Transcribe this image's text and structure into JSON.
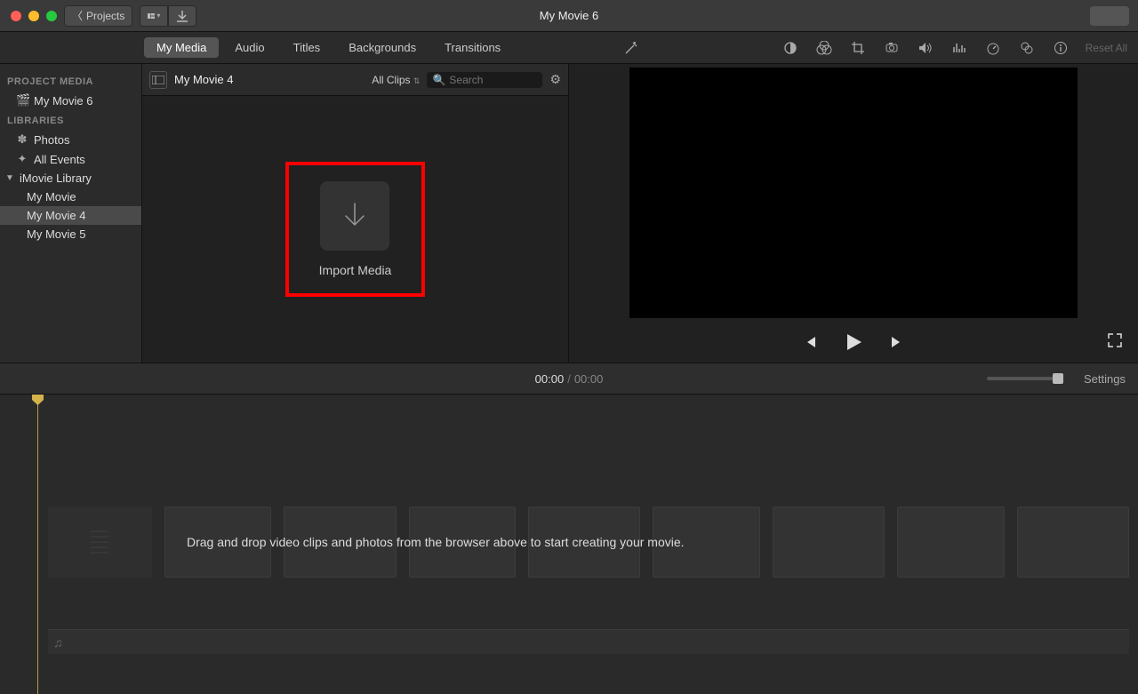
{
  "window": {
    "title": "My Movie 6"
  },
  "toolbar": {
    "back_label": "Projects"
  },
  "tabs": [
    {
      "label": "My Media",
      "active": true
    },
    {
      "label": "Audio"
    },
    {
      "label": "Titles"
    },
    {
      "label": "Backgrounds"
    },
    {
      "label": "Transitions"
    }
  ],
  "adjust_toolbar": {
    "reset_label": "Reset All"
  },
  "sidebar": {
    "sections": [
      {
        "header": "PROJECT MEDIA",
        "items": [
          {
            "label": "My Movie 6",
            "icon": "clapper"
          }
        ]
      },
      {
        "header": "LIBRARIES",
        "items": [
          {
            "label": "Photos",
            "icon": "flower"
          },
          {
            "label": "All Events",
            "icon": "star"
          },
          {
            "label": "iMovie Library",
            "icon": "tri",
            "expanded": true,
            "children": [
              {
                "label": "My Movie"
              },
              {
                "label": "My Movie 4",
                "selected": true
              },
              {
                "label": "My Movie 5"
              }
            ]
          }
        ]
      }
    ]
  },
  "browser": {
    "event_title": "My Movie 4",
    "filter_label": "All Clips",
    "search_placeholder": "Search",
    "import_label": "Import Media"
  },
  "timecode": {
    "current": "00:00",
    "total": "00:00",
    "settings_label": "Settings"
  },
  "timeline": {
    "hint": "Drag and drop video clips and photos from the browser above to start creating your movie."
  }
}
